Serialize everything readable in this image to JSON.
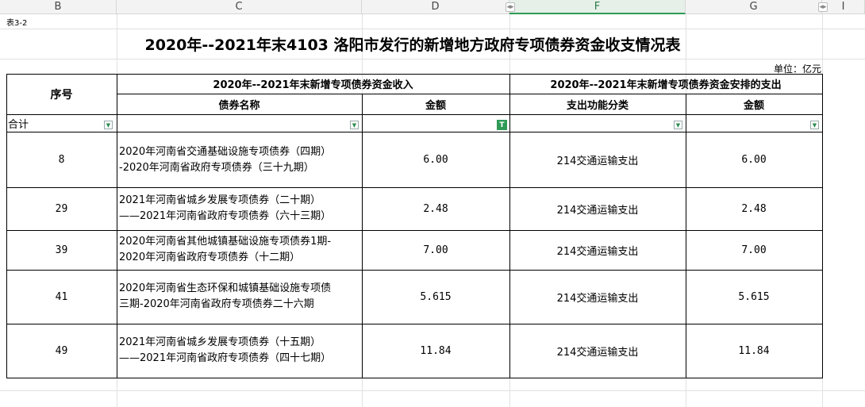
{
  "columns": [
    "B",
    "C",
    "D",
    "F",
    "G",
    "I"
  ],
  "sheet_tag": "表3-2",
  "title": "2020年--2021年末4103 洛阳市发行的新增地方政府专项债券资金收支情况表",
  "unit": "单位：亿元",
  "header": {
    "seq": "序号",
    "income_group": "2020年--2021年末新增专项债券资金收入",
    "expense_group": "2020年--2021年末新增专项债券资金安排的支出",
    "bond_name": "债券名称",
    "amount": "金额",
    "func_class": "支出功能分类",
    "amount2": "金额"
  },
  "total_label": "合计",
  "filter_icons": {
    "dropdown": "▼",
    "active": "T"
  },
  "rows": [
    {
      "seq": "8",
      "name1": "2020年河南省交通基础设施专项债券（四期）",
      "name2": "-2020年河南省政府专项债券（三十九期）",
      "amount": "6.00",
      "func": "214交通运输支出",
      "amount2": "6.00"
    },
    {
      "seq": "29",
      "name1": "2021年河南省城乡发展专项债券（二十期）",
      "name2": "——2021年河南省政府专项债券（六十三期）",
      "amount": "2.48",
      "func": "214交通运输支出",
      "amount2": "2.48"
    },
    {
      "seq": "39",
      "name1": "2020年河南省其他城镇基础设施专项债券1期-",
      "name2": "2020年河南省政府专项债券（十二期）",
      "amount": "7.00",
      "func": "214交通运输支出",
      "amount2": "7.00"
    },
    {
      "seq": "41",
      "name1": "2020年河南省生态环保和城镇基础设施专项债",
      "name2": "三期-2020年河南省政府专项债券二十六期",
      "amount": "5.615",
      "func": "214交通运输支出",
      "amount2": "5.615"
    },
    {
      "seq": "49",
      "name1": "2021年河南省城乡发展专项债券（十五期）",
      "name2": "——2021年河南省政府专项债券（四十七期）",
      "amount": "11.84",
      "func": "214交通运输支出",
      "amount2": "11.84"
    }
  ]
}
